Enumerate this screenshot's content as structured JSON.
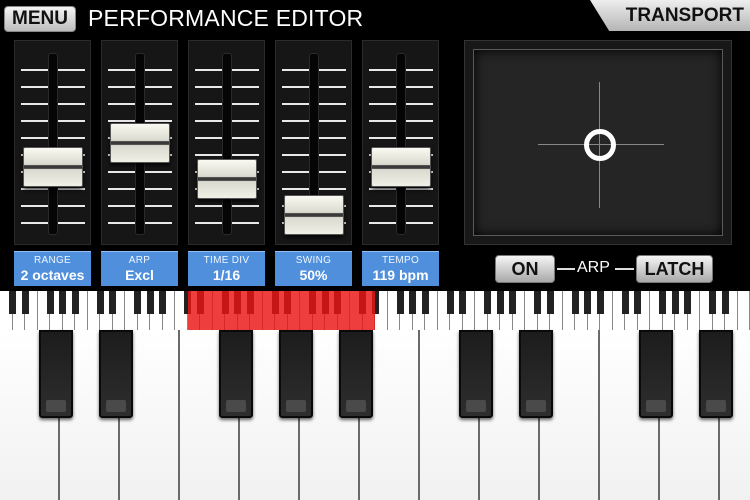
{
  "header": {
    "menu_label": "MENU",
    "title": "PERFORMANCE EDITOR",
    "transport_label": "TRANSPORT"
  },
  "faders": [
    {
      "title": "RANGE",
      "value": "2 octaves"
    },
    {
      "title": "ARP",
      "value": "Excl"
    },
    {
      "title": "TIME DIV",
      "value": "1/16"
    },
    {
      "title": "SWING",
      "value": "50%"
    },
    {
      "title": "TEMPO",
      "value": "119 bpm"
    }
  ],
  "arp": {
    "on_label": "ON",
    "label": "ARP",
    "latch_label": "LATCH"
  },
  "colors": {
    "label_blue": "#4f8fdc",
    "range_highlight": "#eb1414"
  }
}
